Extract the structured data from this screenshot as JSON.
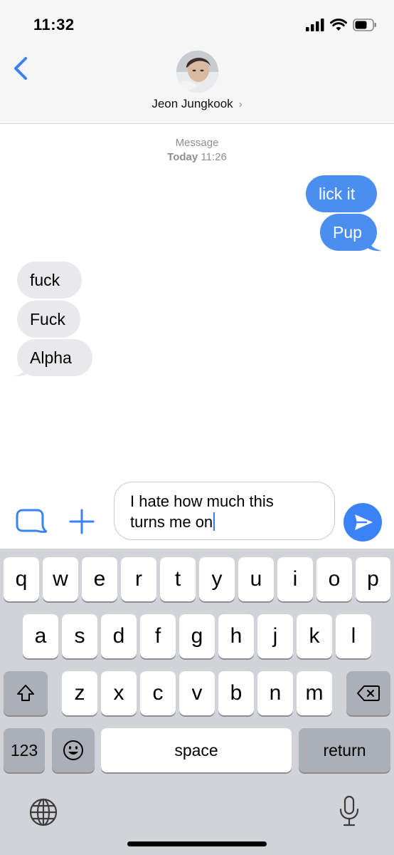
{
  "status_bar": {
    "time": "11:32"
  },
  "header": {
    "contact_name": "Jeon Jungkook",
    "chevron": "›"
  },
  "conversation": {
    "service_label": "Message",
    "day_label": "Today",
    "time_label": "11:26",
    "sent_messages": [
      "lick it",
      "Pup"
    ],
    "received_messages": [
      "fuck",
      "Fuck",
      "Alpha"
    ]
  },
  "composer": {
    "line1": "I hate how much this",
    "line2": "turns me on"
  },
  "keyboard": {
    "row1": [
      "q",
      "w",
      "e",
      "r",
      "t",
      "y",
      "u",
      "i",
      "o",
      "p"
    ],
    "row2": [
      "a",
      "s",
      "d",
      "f",
      "g",
      "h",
      "j",
      "k",
      "l"
    ],
    "row3": [
      "z",
      "x",
      "c",
      "v",
      "b",
      "n",
      "m"
    ],
    "numbers_label": "123",
    "space_label": "space",
    "return_label": "return"
  },
  "icons": {
    "back": "chevron-left-icon",
    "apps": "app-store-icon",
    "add": "plus-icon",
    "send": "arrow-up-icon",
    "shift": "shift-icon",
    "delete": "backspace-icon",
    "emoji": "emoji-icon",
    "globe": "globe-icon",
    "mic": "microphone-icon"
  },
  "colors": {
    "accent": "#3a82f6",
    "sent_bubble": "#4a8ef0",
    "received_bubble": "#e9e9eb",
    "keyboard_bg": "#d1d3d9"
  }
}
